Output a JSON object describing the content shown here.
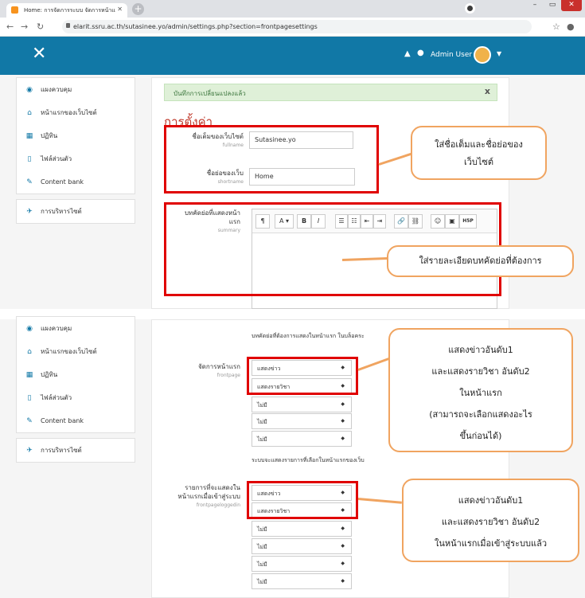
{
  "browser": {
    "tab_title": "Home: การจัดการระบบ จัดการหน้าแ",
    "url": "elarit.ssru.ac.th/sutasinee.yo/admin/settings.php?section=frontpagesettings"
  },
  "navbar": {
    "username": "Admin User"
  },
  "sidebar": {
    "items": [
      {
        "label": "แผงควบคุม",
        "icon": "dashboard-icon"
      },
      {
        "label": "หน้าแรกของเว็บไซต์",
        "icon": "home-icon"
      },
      {
        "label": "ปฏิทิน",
        "icon": "calendar-icon"
      },
      {
        "label": "ไฟล์ส่วนตัว",
        "icon": "file-icon"
      },
      {
        "label": "Content bank",
        "icon": "pencil-icon"
      }
    ],
    "admin_item": {
      "label": "การบริหารไซต์",
      "icon": "wrench-icon"
    }
  },
  "alert": {
    "text": "บันทึกการเปลี่ยนแปลงแล้ว",
    "close": "x"
  },
  "page_title": "การตั้งค่า",
  "settings": {
    "fullname": {
      "label": "ชื่อเต็มของเว็บไซต์",
      "code": "fullname",
      "value": "Sutasinee.yo"
    },
    "shortname": {
      "label": "ชื่อย่อของเว็บ",
      "code": "shortname",
      "value": "Home"
    },
    "summary": {
      "label_line1": "บทคัดย่อที่แสดงหน้า",
      "label_line2": "แรก",
      "code": "summary"
    },
    "frontpage": {
      "label": "จัดการหน้าแรก",
      "code": "frontpage",
      "note_above": "บทคัดย่อที่ต้องการแสดงในหน้าแรก ในบล็อคระ",
      "options": [
        "แสดงข่าว",
        "แสดงรายวิชา",
        "ไม่มี",
        "ไม่มี",
        "ไม่มี"
      ],
      "note_below": "ระบบจะแสดงรายการที่เลือกในหน้าแรกของเว็บ"
    },
    "frontpageloggedin": {
      "label_line1": "รายการที่จะแสดงใน",
      "label_line2": "หน้าแรกเมื่อเข้าสู่ระบบ",
      "code": "frontpageloggedin",
      "options": [
        "แสดงข่าว",
        "แสดงรายวิชา",
        "ไม่มี",
        "ไม่มี",
        "ไม่มี",
        "ไม่มี"
      ]
    }
  },
  "editor_toolbar": [
    "¶",
    "A ▾",
    "B",
    "I",
    "☰",
    "☷",
    "⇤",
    "⇥",
    "🔗",
    "⛓",
    "☺",
    "▣",
    "H5P"
  ],
  "callouts": {
    "names": {
      "line1": "ใส่ชื่อเต็มและชื่อย่อของ",
      "line2": "เว็บไซต์"
    },
    "summary": {
      "line1": "ใส่รายละเอียดบทคัดย่อที่ต้องการ"
    },
    "frontpage": {
      "line1": "แสดงข่าวอันดับ1",
      "line2": "และแสดงรายวิชา อันดับ2",
      "line3": "ในหน้าแรก",
      "line4": "(สามารถจะเลือกแสดงอะไร",
      "line5": "ขึ้นก่อนได้)"
    },
    "loggedin": {
      "line1": "แสดงข่าวอันดับ1",
      "line2": "และแสดงรายวิชา อันดับ2",
      "line3": "ในหน้าแรกเมื่อเข้าสู่ระบบแล้ว"
    }
  },
  "colors": {
    "navbar": "#1178a6",
    "highlight": "#e00000",
    "callout_border": "#f0a460",
    "title": "#c0392b"
  }
}
